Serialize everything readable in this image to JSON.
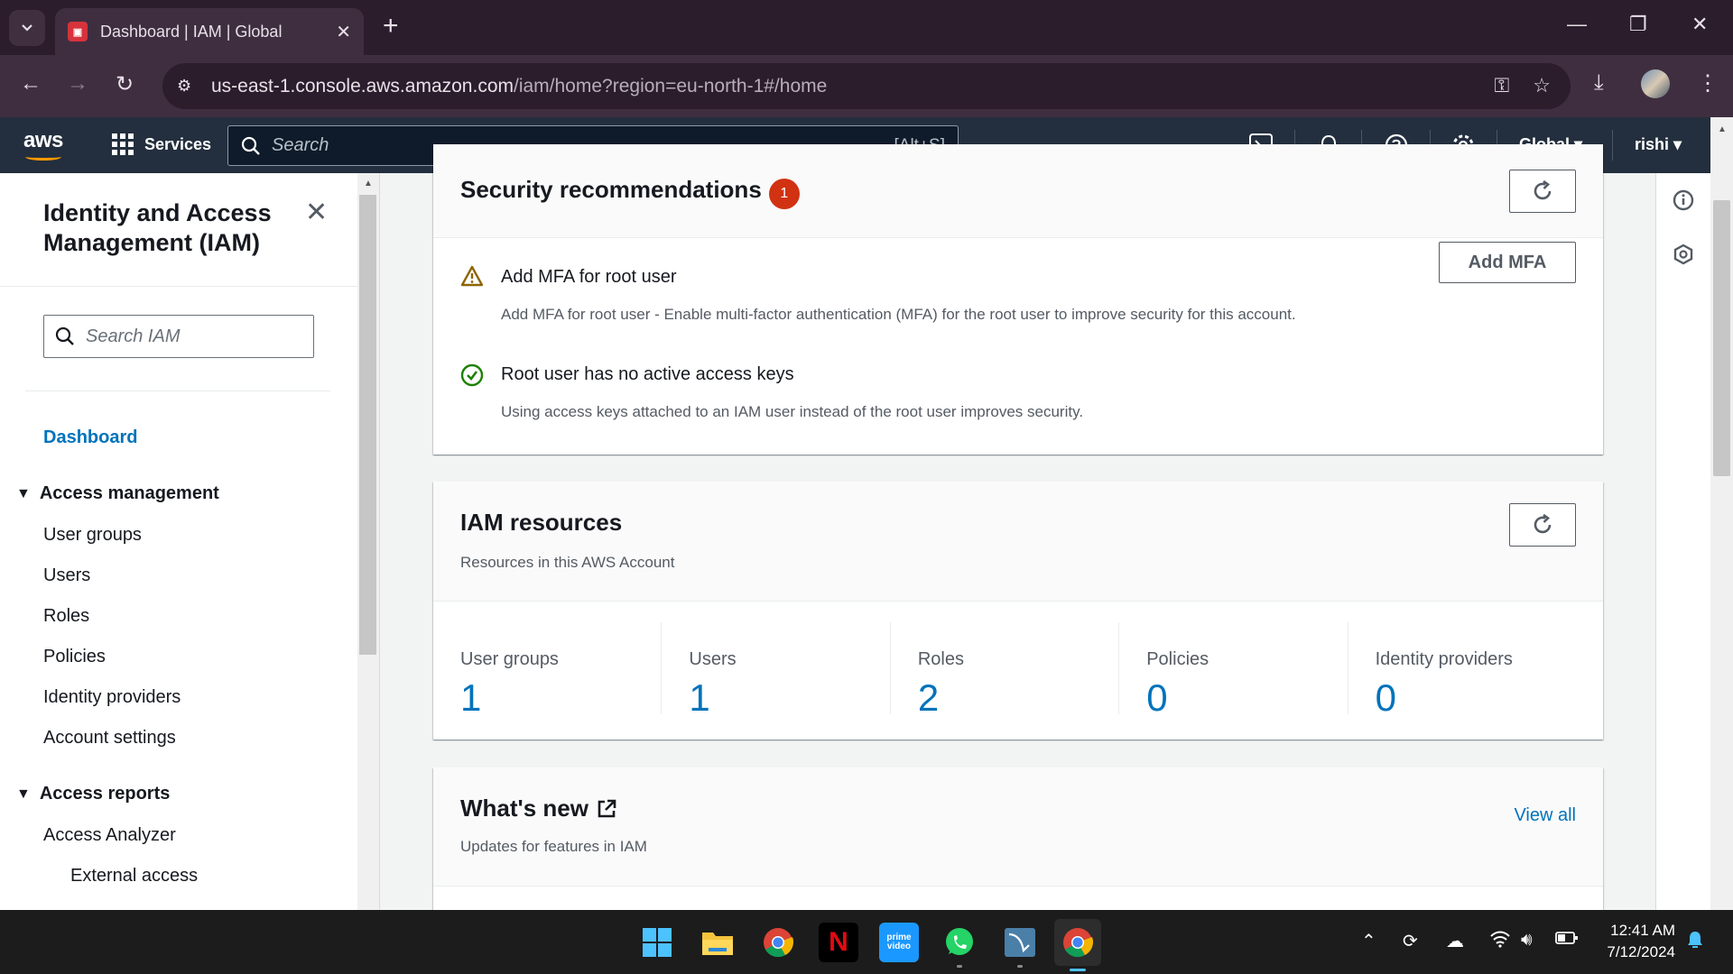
{
  "browser": {
    "tab_title": "Dashboard | IAM | Global",
    "url_host": "us-east-1.console.aws.amazon.com",
    "url_path": "/iam/home?region=eu-north-1#/home"
  },
  "aws_header": {
    "logo": "aws",
    "services_label": "Services",
    "search_placeholder": "Search",
    "search_shortcut": "[Alt+S]",
    "region_label": "Global",
    "user_label": "rishi"
  },
  "sidebar": {
    "title": "Identity and Access Management (IAM)",
    "search_placeholder": "Search IAM",
    "dashboard_label": "Dashboard",
    "sections": [
      {
        "label": "Access management",
        "items": [
          "User groups",
          "Users",
          "Roles",
          "Policies",
          "Identity providers",
          "Account settings"
        ]
      },
      {
        "label": "Access reports",
        "items": [
          "Access Analyzer",
          "External access"
        ]
      }
    ]
  },
  "security": {
    "title": "Security recommendations",
    "badge_count": "1",
    "recommendations": [
      {
        "title": "Add MFA for root user",
        "description": "Add MFA for root user - Enable multi-factor authentication (MFA) for the root user to improve security for this account.",
        "status": "warning",
        "action_label": "Add MFA"
      },
      {
        "title": "Root user has no active access keys",
        "description": "Using access keys attached to an IAM user instead of the root user improves security.",
        "status": "success"
      }
    ]
  },
  "resources": {
    "title": "IAM resources",
    "subtitle": "Resources in this AWS Account",
    "items": [
      {
        "label": "User groups",
        "value": "1"
      },
      {
        "label": "Users",
        "value": "1"
      },
      {
        "label": "Roles",
        "value": "2"
      },
      {
        "label": "Policies",
        "value": "0"
      },
      {
        "label": "Identity providers",
        "value": "0"
      }
    ]
  },
  "whats_new": {
    "title": "What's new",
    "subtitle": "Updates for features in IAM",
    "view_all_label": "View all"
  },
  "taskbar": {
    "time": "12:41 AM",
    "date": "7/12/2024"
  },
  "colors": {
    "aws_nav_bg": "#232f3e",
    "link_blue": "#0073bb",
    "badge_red": "#d13212",
    "warning": "#8d6605",
    "success": "#1d8102"
  }
}
